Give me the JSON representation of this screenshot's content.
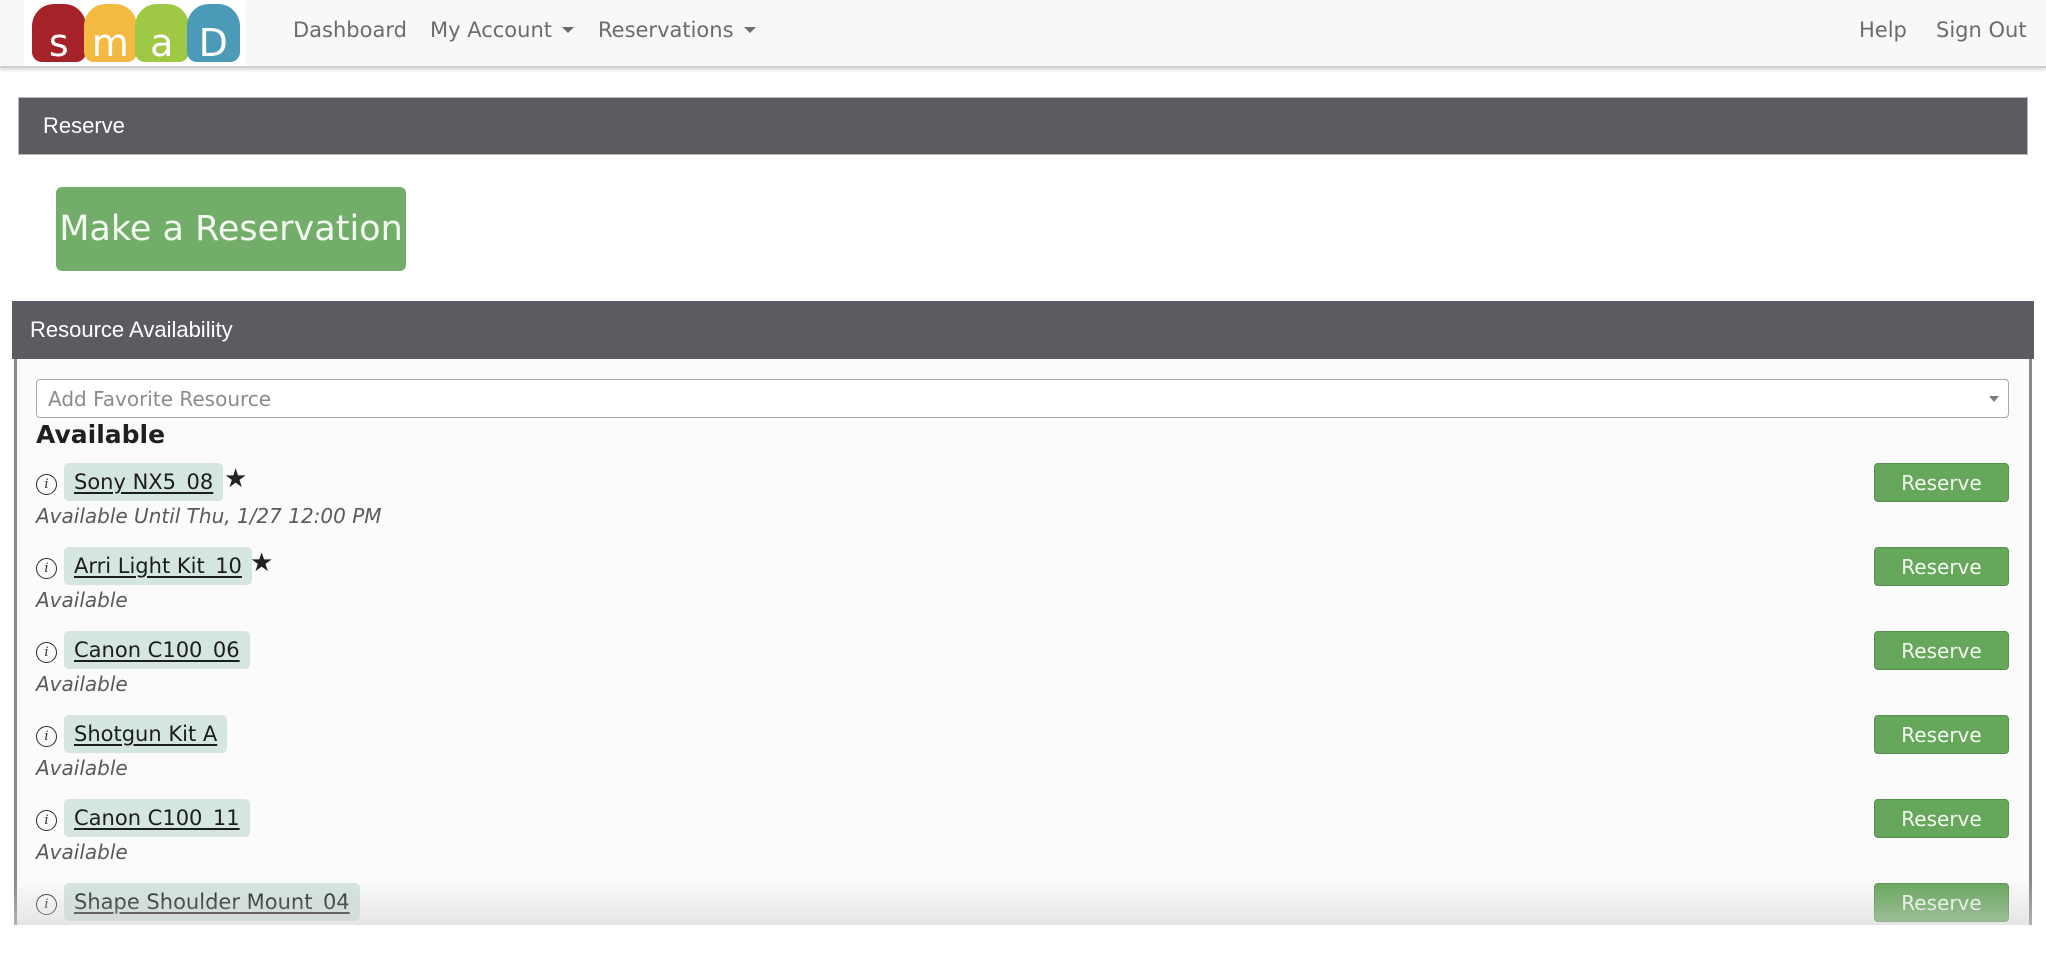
{
  "navbar": {
    "logo_letters": [
      "s",
      "m",
      "a",
      "D"
    ],
    "links": {
      "dashboard": "Dashboard",
      "my_account": "My Account",
      "reservations": "Reservations",
      "help": "Help",
      "sign_out": "Sign Out"
    }
  },
  "reserve_panel": {
    "title": "Reserve",
    "make_reservation_label": "Make a Reservation"
  },
  "resource_panel": {
    "title": "Resource Availability",
    "favorite_select_placeholder": "Add Favorite Resource",
    "section_title": "Available",
    "reserve_label": "Reserve",
    "items": [
      {
        "name": "Sony NX5_08",
        "status": "Available Until Thu, 1/27 12:00 PM",
        "favorite": true
      },
      {
        "name": "Arri Light Kit_10",
        "status": "Available",
        "favorite": true
      },
      {
        "name": "Canon C100_06",
        "status": "Available",
        "favorite": false
      },
      {
        "name": "Shotgun Kit A",
        "status": "Available",
        "favorite": false
      },
      {
        "name": "Canon C100_11",
        "status": "Available",
        "favorite": false
      },
      {
        "name": "Shape Shoulder Mount_04",
        "status": "",
        "favorite": false
      }
    ]
  },
  "icons": {
    "info": "ⓘ",
    "star": "★"
  },
  "colors": {
    "panel_header": "#5d5b62",
    "reserve_button": "#67a75c",
    "make_reservation_button": "#73ad6a",
    "resource_chip": "#d5e5df",
    "logo_s": "#a52229",
    "logo_m": "#f4b941",
    "logo_a": "#9fc845",
    "logo_d": "#4a9ab8"
  }
}
